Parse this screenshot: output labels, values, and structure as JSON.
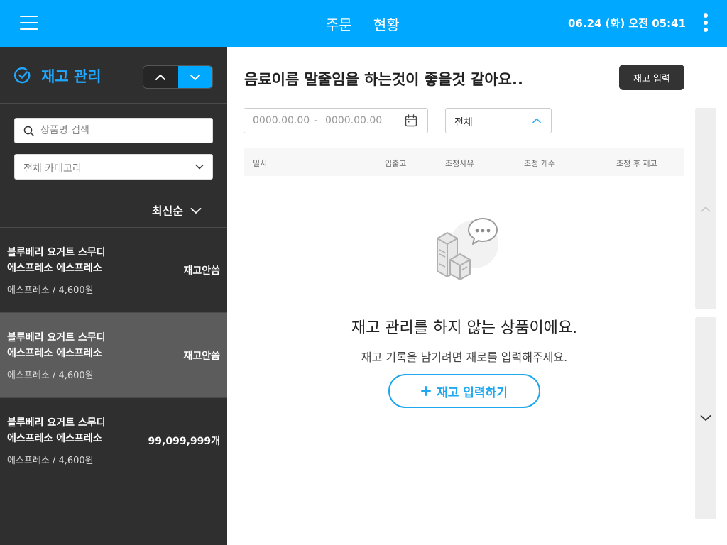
{
  "topbar": {
    "tabs": [
      {
        "label": "주문"
      },
      {
        "label": "현황"
      }
    ],
    "datetime": "06.24 (화) 오전 05:41",
    "color": "#00a8ff"
  },
  "sidebar": {
    "title": "재고 관리",
    "search_placeholder": "상품명 검색",
    "category_label": "전체 카테고리",
    "sort_label": "최신순",
    "products": [
      {
        "name_line1": "블루베리 요거트 스무디",
        "name_line2": "에스프레소 에스프레소",
        "meta": "에스프레소 / 4,600원",
        "stock": "재고안씀",
        "selected": false
      },
      {
        "name_line1": "블루베리 요거트 스무디",
        "name_line2": "에스프레소 에스프레소",
        "meta": "에스프레소 / 4,600원",
        "stock": "재고안씀",
        "selected": true
      },
      {
        "name_line1": "블루베리 요거트 스무디",
        "name_line2": "에스프레소 에스프레소",
        "meta": "에스프레소 / 4,600원",
        "stock": "99,099,999개",
        "selected": false
      }
    ]
  },
  "main": {
    "title": "음료이름 말줄임을 하는것이 좋을것 같아요..",
    "stock_input_label": "재고 입력",
    "date_start": "0000.00.00",
    "date_separator": "-",
    "date_end": "0000.00.00",
    "type_filter_label": "전체",
    "table_columns": [
      "일시",
      "입출고",
      "조정사유",
      "조정 개수",
      "조정 후 재고"
    ],
    "empty_title": "재고 관리를 하지 않는 상품이에요.",
    "empty_desc": "재고 기록을 남기려면 재로를 입력해주세요.",
    "empty_button_label": "재고 입력하기"
  }
}
